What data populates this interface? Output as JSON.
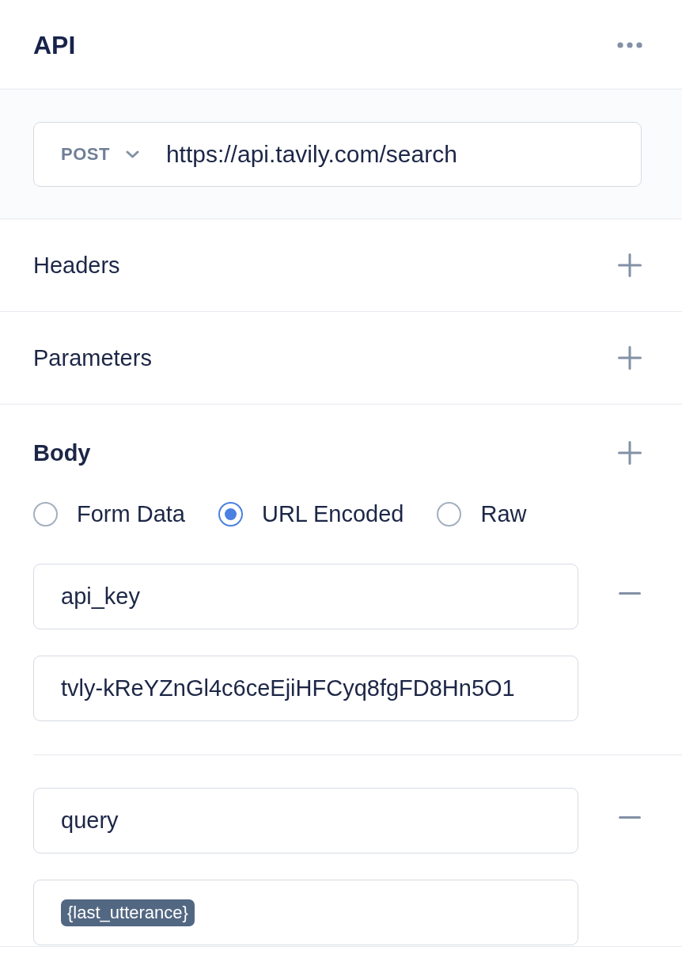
{
  "panel": {
    "title": "API"
  },
  "request": {
    "method": "POST",
    "url": "https://api.tavily.com/search"
  },
  "sections": [
    {
      "label": "Headers",
      "expanded": false
    },
    {
      "label": "Parameters",
      "expanded": false
    },
    {
      "label": "Body",
      "expanded": true,
      "encodings": [
        {
          "label": "Form Data",
          "selected": false
        },
        {
          "label": "URL Encoded",
          "selected": true
        },
        {
          "label": "Raw",
          "selected": false
        }
      ],
      "pairs": [
        {
          "key": "api_key",
          "kind": "text",
          "value": "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"
        },
        {
          "key": "query",
          "kind": "variable",
          "value": "{last_utterance}"
        }
      ]
    }
  ]
}
